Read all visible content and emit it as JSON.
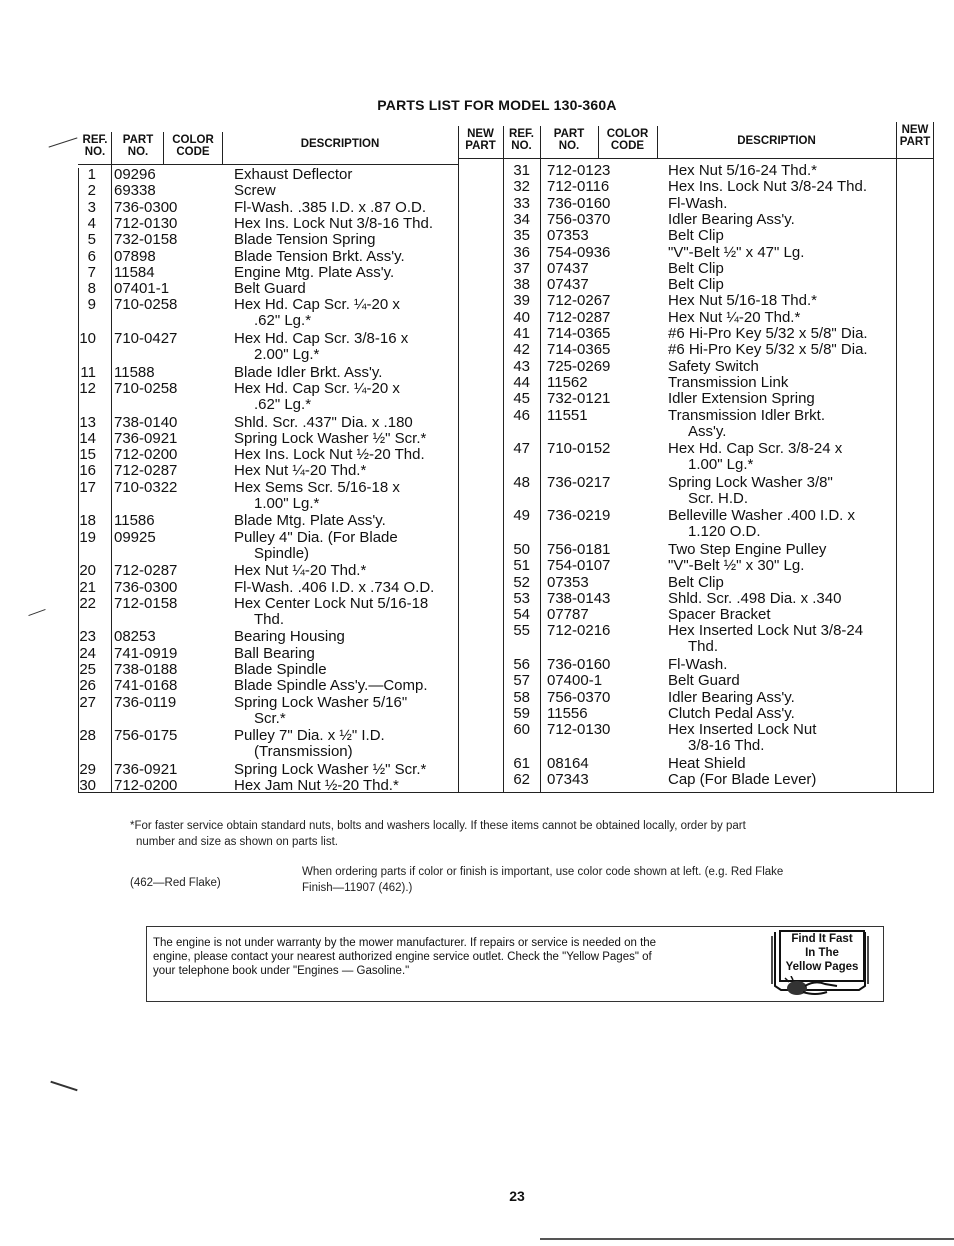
{
  "title": "PARTS LIST FOR MODEL 130-360A",
  "headers": {
    "ref": [
      "REF.",
      "NO."
    ],
    "part": [
      "PART",
      "NO."
    ],
    "color": [
      "COLOR",
      "CODE"
    ],
    "description": "DESCRIPTION",
    "new_part": [
      "NEW",
      "PART"
    ]
  },
  "left_rows": [
    {
      "ref": "1",
      "part": "09296",
      "desc": [
        "Exhaust Deflector"
      ]
    },
    {
      "ref": "2",
      "part": "69338",
      "desc": [
        "Screw"
      ]
    },
    {
      "ref": "3",
      "part": "736-0300",
      "desc": [
        "Fl-Wash. .385 I.D. x .87 O.D."
      ]
    },
    {
      "ref": "4",
      "part": "712-0130",
      "desc": [
        "Hex Ins. Lock Nut 3/8-16 Thd."
      ]
    },
    {
      "ref": "5",
      "part": "732-0158",
      "desc": [
        "Blade Tension Spring"
      ]
    },
    {
      "ref": "6",
      "part": "07898",
      "desc": [
        "Blade Tension Brkt. Ass'y."
      ]
    },
    {
      "ref": "7",
      "part": "11584",
      "desc": [
        "Engine Mtg. Plate Ass'y."
      ]
    },
    {
      "ref": "8",
      "part": "07401-1",
      "desc": [
        "Belt Guard"
      ]
    },
    {
      "ref": "9",
      "part": "710-0258",
      "desc": [
        "Hex Hd. Cap Scr. ¼-20 x",
        ".62\" Lg.*"
      ]
    },
    {
      "ref": "10",
      "part": "710-0427",
      "desc": [
        "Hex Hd. Cap Scr. 3/8-16 x",
        "2.00\" Lg.*"
      ]
    },
    {
      "ref": "11",
      "part": "11588",
      "desc": [
        "Blade Idler Brkt. Ass'y."
      ]
    },
    {
      "ref": "12",
      "part": "710-0258",
      "desc": [
        "Hex Hd. Cap Scr. ¼-20 x",
        ".62\" Lg.*"
      ]
    },
    {
      "ref": "13",
      "part": "738-0140",
      "desc": [
        "Shld. Scr. .437\" Dia. x .180"
      ]
    },
    {
      "ref": "14",
      "part": "736-0921",
      "desc": [
        "Spring Lock Washer ½\" Scr.*"
      ]
    },
    {
      "ref": "15",
      "part": "712-0200",
      "desc": [
        "Hex Ins. Lock Nut ½-20 Thd."
      ]
    },
    {
      "ref": "16",
      "part": "712-0287",
      "desc": [
        "Hex Nut ¼-20 Thd.*"
      ]
    },
    {
      "ref": "17",
      "part": "710-0322",
      "desc": [
        "Hex Sems Scr. 5/16-18 x",
        "1.00\" Lg.*"
      ]
    },
    {
      "ref": "18",
      "part": "11586",
      "desc": [
        "Blade Mtg. Plate Ass'y."
      ]
    },
    {
      "ref": "19",
      "part": "09925",
      "desc": [
        "Pulley 4\" Dia. (For Blade",
        "Spindle)"
      ]
    },
    {
      "ref": "20",
      "part": "712-0287",
      "desc": [
        "Hex Nut ¼-20 Thd.*"
      ]
    },
    {
      "ref": "21",
      "part": "736-0300",
      "desc": [
        "Fl-Wash. .406 I.D. x .734 O.D."
      ]
    },
    {
      "ref": "22",
      "part": "712-0158",
      "desc": [
        "Hex Center Lock Nut 5/16-18",
        "Thd."
      ]
    },
    {
      "ref": "23",
      "part": "08253",
      "desc": [
        "Bearing Housing"
      ]
    },
    {
      "ref": "24",
      "part": "741-0919",
      "desc": [
        "Ball Bearing"
      ]
    },
    {
      "ref": "25",
      "part": "738-0188",
      "desc": [
        "Blade Spindle"
      ]
    },
    {
      "ref": "26",
      "part": "741-0168",
      "desc": [
        "Blade Spindle Ass'y.—Comp."
      ]
    },
    {
      "ref": "27",
      "part": "736-0119",
      "desc": [
        "Spring Lock Washer 5/16\"",
        "Scr.*"
      ]
    },
    {
      "ref": "28",
      "part": "756-0175",
      "desc": [
        "Pulley 7\" Dia. x ½\" I.D.",
        "(Transmission)"
      ]
    },
    {
      "ref": "29",
      "part": "736-0921",
      "desc": [
        "Spring Lock Washer ½\" Scr.*"
      ]
    },
    {
      "ref": "30",
      "part": "712-0200",
      "desc": [
        "Hex Jam Nut ½-20 Thd.*"
      ]
    }
  ],
  "right_rows": [
    {
      "ref": "31",
      "part": "712-0123",
      "desc": [
        "Hex Nut 5/16-24 Thd.*"
      ]
    },
    {
      "ref": "32",
      "part": "712-0116",
      "desc": [
        "Hex Ins. Lock Nut 3/8-24 Thd."
      ]
    },
    {
      "ref": "33",
      "part": "736-0160",
      "desc": [
        "Fl-Wash."
      ]
    },
    {
      "ref": "34",
      "part": "756-0370",
      "desc": [
        "Idler Bearing Ass'y."
      ]
    },
    {
      "ref": "35",
      "part": "07353",
      "desc": [
        "Belt Clip"
      ]
    },
    {
      "ref": "36",
      "part": "754-0936",
      "desc": [
        "\"V\"-Belt ½\" x 47\" Lg."
      ]
    },
    {
      "ref": "37",
      "part": "07437",
      "desc": [
        "Belt Clip"
      ]
    },
    {
      "ref": "38",
      "part": "07437",
      "desc": [
        "Belt Clip"
      ]
    },
    {
      "ref": "39",
      "part": "712-0267",
      "desc": [
        "Hex Nut 5/16-18 Thd.*"
      ]
    },
    {
      "ref": "40",
      "part": "712-0287",
      "desc": [
        "Hex Nut ¼-20 Thd.*"
      ]
    },
    {
      "ref": "41",
      "part": "714-0365",
      "desc": [
        "#6 Hi-Pro Key 5/32 x 5/8\" Dia."
      ]
    },
    {
      "ref": "42",
      "part": "714-0365",
      "desc": [
        "#6 Hi-Pro Key 5/32 x 5/8\" Dia."
      ]
    },
    {
      "ref": "43",
      "part": "725-0269",
      "desc": [
        "Safety Switch"
      ]
    },
    {
      "ref": "44",
      "part": "11562",
      "desc": [
        "Transmission Link"
      ]
    },
    {
      "ref": "45",
      "part": "732-0121",
      "desc": [
        "Idler Extension Spring"
      ]
    },
    {
      "ref": "46",
      "part": "11551",
      "desc": [
        "Transmission Idler Brkt.",
        "Ass'y."
      ]
    },
    {
      "ref": "47",
      "part": "710-0152",
      "desc": [
        "Hex Hd. Cap Scr. 3/8-24 x",
        "1.00\" Lg.*"
      ]
    },
    {
      "ref": "48",
      "part": "736-0217",
      "desc": [
        "Spring Lock Washer 3/8\"",
        "Scr. H.D."
      ]
    },
    {
      "ref": "49",
      "part": "736-0219",
      "desc": [
        "Belleville Washer .400 I.D. x",
        "1.120 O.D."
      ]
    },
    {
      "ref": "50",
      "part": "756-0181",
      "desc": [
        "Two Step Engine Pulley"
      ]
    },
    {
      "ref": "51",
      "part": "754-0107",
      "desc": [
        "\"V\"-Belt ½\" x 30\" Lg."
      ]
    },
    {
      "ref": "52",
      "part": "07353",
      "desc": [
        "Belt Clip"
      ]
    },
    {
      "ref": "53",
      "part": "738-0143",
      "desc": [
        "Shld. Scr. .498 Dia. x .340"
      ]
    },
    {
      "ref": "54",
      "part": "07787",
      "desc": [
        "Spacer Bracket"
      ]
    },
    {
      "ref": "55",
      "part": "712-0216",
      "desc": [
        "Hex Inserted Lock Nut 3/8-24",
        "Thd."
      ]
    },
    {
      "ref": "56",
      "part": "736-0160",
      "desc": [
        "Fl-Wash."
      ]
    },
    {
      "ref": "57",
      "part": "07400-1",
      "desc": [
        "Belt Guard"
      ]
    },
    {
      "ref": "58",
      "part": "756-0370",
      "desc": [
        "Idler Bearing Ass'y."
      ]
    },
    {
      "ref": "59",
      "part": "11556",
      "desc": [
        "Clutch Pedal Ass'y."
      ]
    },
    {
      "ref": "60",
      "part": "712-0130",
      "desc": [
        "Hex Inserted Lock Nut",
        "3/8-16 Thd."
      ]
    },
    {
      "ref": "61",
      "part": "08164",
      "desc": [
        "Heat Shield"
      ]
    },
    {
      "ref": "62",
      "part": "07343",
      "desc": [
        "Cap (For Blade Lever)"
      ]
    }
  ],
  "footnotes": {
    "asterisk_note_line1": "*For faster service obtain standard nuts, bolts and washers locally. If these items cannot be obtained locally, order by part",
    "asterisk_note_line2": "number and size as shown on parts list.",
    "color_example_label": "(462—Red Flake)",
    "color_note_line1": "When ordering parts if color or finish is important, use color code shown at left. (e.g. Red Flake",
    "color_note_line2": "Finish—11907 (462).)"
  },
  "engine_notice": {
    "text_line1": "The engine is not under warranty by the mower manufacturer. If repairs or service is needed on the",
    "text_line2": "engine, please contact your nearest authorized engine service outlet. Check the \"Yellow Pages\" of",
    "text_line3": "your telephone book under \"Engines — Gasoline.\"",
    "badge_line1": "Find It Fast",
    "badge_line2": "In The",
    "badge_line3": "Yellow Pages"
  },
  "page_number": "23"
}
